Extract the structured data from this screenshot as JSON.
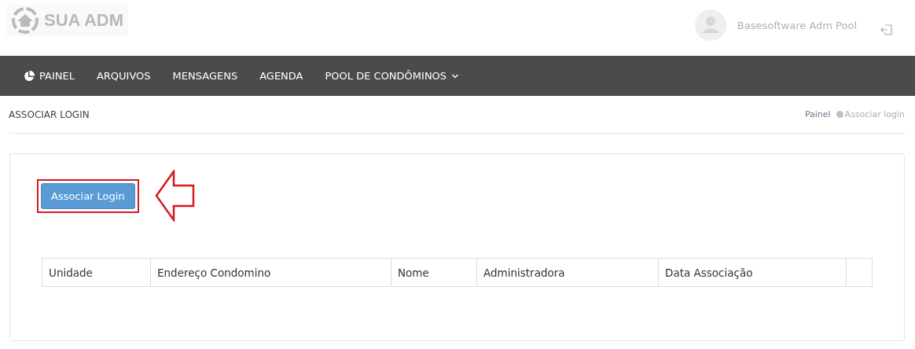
{
  "logo": {
    "text": "SUA ADM"
  },
  "user": {
    "name": "Basesoftware Adm Pool"
  },
  "nav": [
    {
      "label": "PAINEL",
      "icon": true,
      "dropdown": false
    },
    {
      "label": "ARQUIVOS",
      "icon": false,
      "dropdown": false
    },
    {
      "label": "MENSAGENS",
      "icon": false,
      "dropdown": false
    },
    {
      "label": "AGENDA",
      "icon": false,
      "dropdown": false
    },
    {
      "label": "POOL DE CONDÔMINOS",
      "icon": false,
      "dropdown": true
    }
  ],
  "page_title": "ASSOCIAR LOGIN",
  "breadcrumb": [
    "Painel",
    "Associar login"
  ],
  "action_button": {
    "label": "Associar Login",
    "highlighted": true
  },
  "table": {
    "columns": [
      "Unidade",
      "Endereço Condomino",
      "Nome",
      "Administradora",
      "Data Associação",
      ""
    ]
  }
}
